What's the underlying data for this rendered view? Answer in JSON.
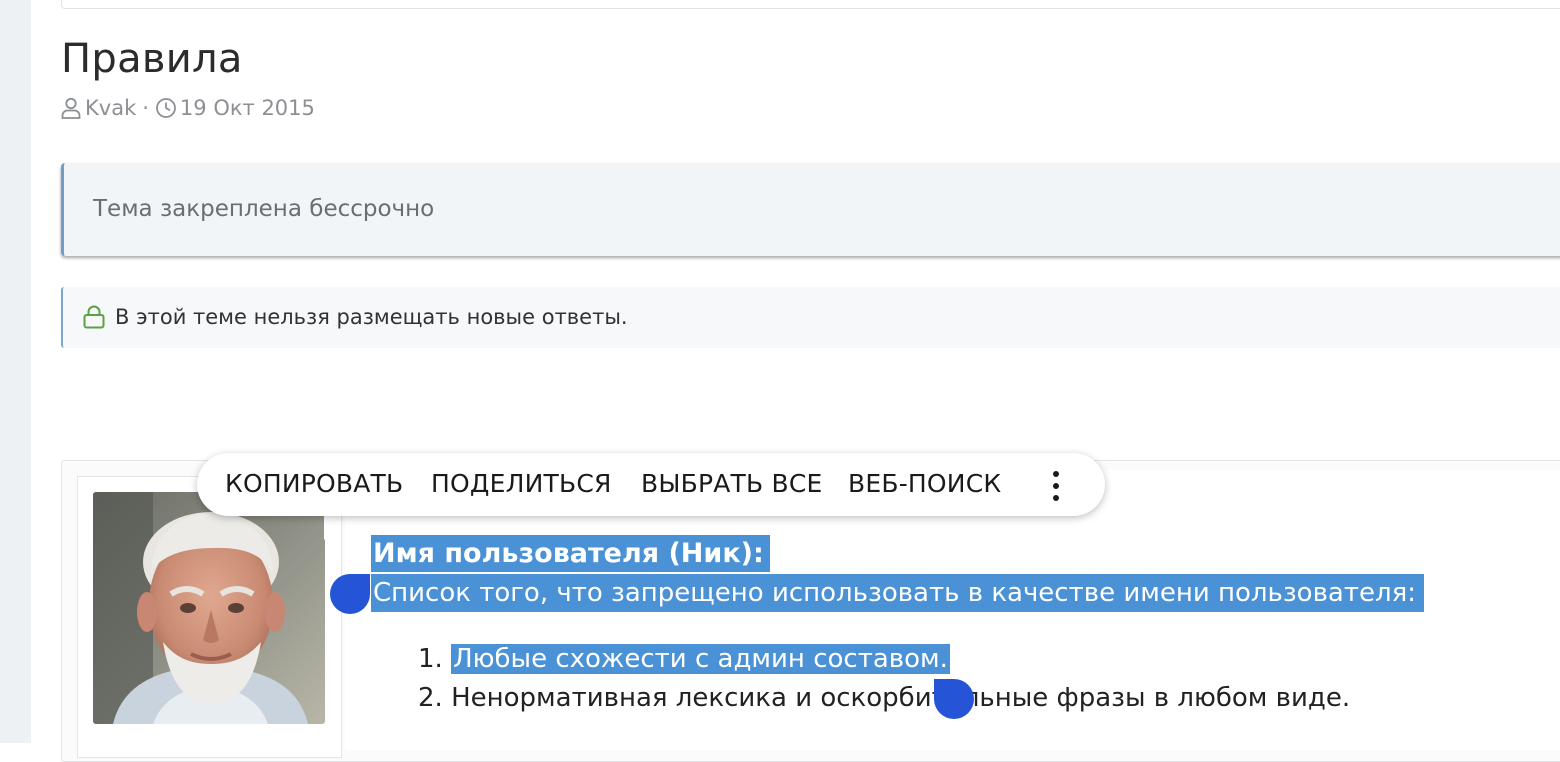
{
  "thread": {
    "title": "Правила",
    "author": "Kvak",
    "date": "19 Окт 2015",
    "author_icon": "user-icon",
    "date_icon": "clock-icon"
  },
  "notices": {
    "sticky": "Тема закреплена бессрочно",
    "locked": "В этой теме нельзя размещать новые ответы.",
    "locked_icon": "lock-icon"
  },
  "post": {
    "heading": "Имя пользователя (Ник):",
    "intro": "Список того, что запрещено использовать в качестве имени пользователя:",
    "list": [
      {
        "num": "1.",
        "text": "Любые схожести с админ составом."
      },
      {
        "num": "2.",
        "text": "Ненормативная лексика и оскорбительные фразы в любом виде."
      }
    ]
  },
  "context_menu": {
    "copy": "КОПИРОВАТЬ",
    "share": "ПОДЕЛИТЬСЯ",
    "select_all": "ВЫБРАТЬ ВСЕ",
    "web_search": "ВЕБ-ПОИСК",
    "more_icon": "more-vertical-icon"
  },
  "colors": {
    "selection": "#4a91d6",
    "selection_handle": "#2555d6",
    "notice_border": "#6c9ec9",
    "lock_green": "#5aa145"
  }
}
